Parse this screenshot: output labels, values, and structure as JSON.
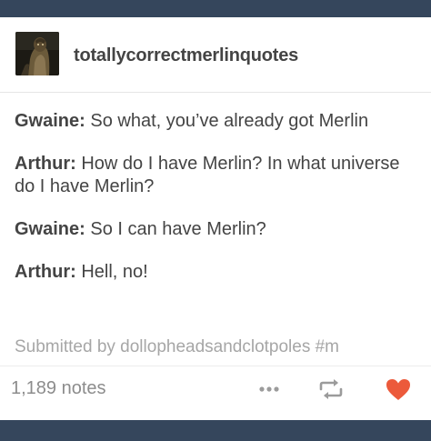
{
  "post": {
    "blog_name": "totallycorrectmerlinquotes",
    "avatar_icon": "avatar-image",
    "quotes": [
      {
        "speaker": "Gwaine",
        "text": " So what, you’ve already got Merlin"
      },
      {
        "speaker": "Arthur",
        "text": " How do I have Merlin? In what universe do I have Merlin?"
      },
      {
        "speaker": "Gwaine",
        "text": " So I can have Merlin?"
      },
      {
        "speaker": "Arthur",
        "text": " Hell, no!"
      }
    ],
    "quote_separator": ":",
    "source_text": "Submitted by dollopheadsandclotpoles   #m",
    "notes_label": "1,189 notes",
    "icons": {
      "more": "more-dots-icon",
      "reblog": "reblog-icon",
      "like": "heart-icon"
    },
    "colors": {
      "background": "#35465c",
      "heart": "#ec5a3b",
      "icon_gray": "#9b9b9b"
    }
  }
}
